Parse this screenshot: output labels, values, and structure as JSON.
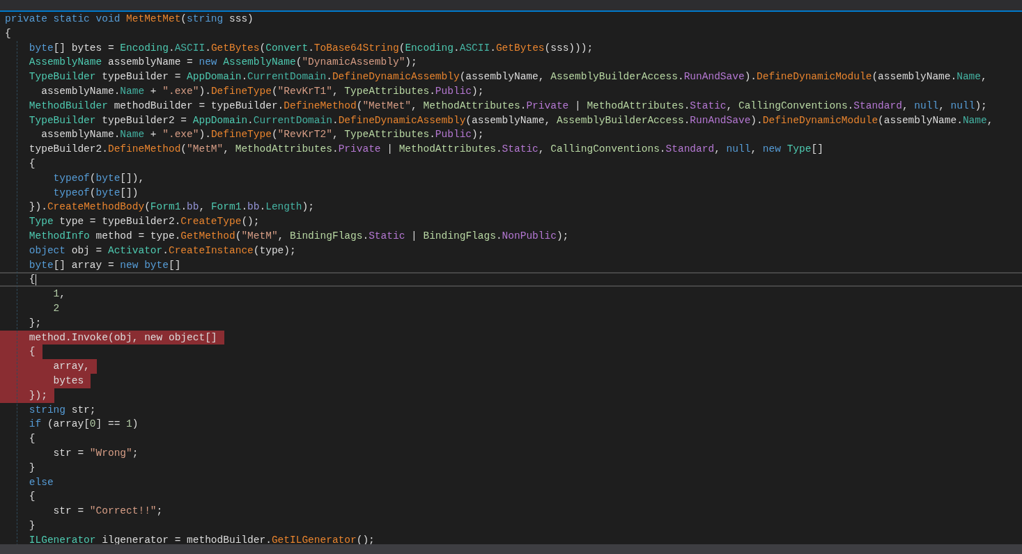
{
  "code_lines": [
    {
      "highlighted": false,
      "current": false,
      "tokens": [
        {
          "kind": "keyword",
          "text": "private static void "
        },
        {
          "kind": "method",
          "text": "MetMetMet"
        },
        {
          "kind": "plain",
          "text": "("
        },
        {
          "kind": "keyword",
          "text": "string"
        },
        {
          "kind": "plain",
          "text": " sss)"
        }
      ]
    },
    {
      "highlighted": false,
      "current": false,
      "tokens": [
        {
          "kind": "plain",
          "text": "{"
        }
      ]
    },
    {
      "highlighted": false,
      "current": false,
      "tokens": [
        {
          "kind": "keyword",
          "text": "    byte"
        },
        {
          "kind": "plain",
          "text": "[] bytes = "
        },
        {
          "kind": "type",
          "text": "Encoding"
        },
        {
          "kind": "plain",
          "text": "."
        },
        {
          "kind": "property",
          "text": "ASCII"
        },
        {
          "kind": "plain",
          "text": "."
        },
        {
          "kind": "method",
          "text": "GetBytes"
        },
        {
          "kind": "plain",
          "text": "("
        },
        {
          "kind": "type",
          "text": "Convert"
        },
        {
          "kind": "plain",
          "text": "."
        },
        {
          "kind": "method",
          "text": "ToBase64String"
        },
        {
          "kind": "plain",
          "text": "("
        },
        {
          "kind": "type",
          "text": "Encoding"
        },
        {
          "kind": "plain",
          "text": "."
        },
        {
          "kind": "property",
          "text": "ASCII"
        },
        {
          "kind": "plain",
          "text": "."
        },
        {
          "kind": "method",
          "text": "GetBytes"
        },
        {
          "kind": "plain",
          "text": "(sss)));"
        }
      ]
    },
    {
      "highlighted": false,
      "current": false,
      "tokens": [
        {
          "kind": "type",
          "text": "    AssemblyName"
        },
        {
          "kind": "plain",
          "text": " assemblyName = "
        },
        {
          "kind": "keyword",
          "text": "new "
        },
        {
          "kind": "type",
          "text": "AssemblyName"
        },
        {
          "kind": "plain",
          "text": "("
        },
        {
          "kind": "string",
          "text": "\"DynamicAssembly\""
        },
        {
          "kind": "plain",
          "text": ");"
        }
      ]
    },
    {
      "highlighted": false,
      "current": false,
      "tokens": [
        {
          "kind": "type",
          "text": "    TypeBuilder"
        },
        {
          "kind": "plain",
          "text": " typeBuilder = "
        },
        {
          "kind": "type",
          "text": "AppDomain"
        },
        {
          "kind": "plain",
          "text": "."
        },
        {
          "kind": "property",
          "text": "CurrentDomain"
        },
        {
          "kind": "plain",
          "text": "."
        },
        {
          "kind": "method",
          "text": "DefineDynamicAssembly"
        },
        {
          "kind": "plain",
          "text": "(assemblyName, "
        },
        {
          "kind": "enum",
          "text": "AssemblyBuilderAccess"
        },
        {
          "kind": "plain",
          "text": "."
        },
        {
          "kind": "value",
          "text": "RunAndSave"
        },
        {
          "kind": "plain",
          "text": ")."
        },
        {
          "kind": "method",
          "text": "DefineDynamicModule"
        },
        {
          "kind": "plain",
          "text": "(assemblyName."
        },
        {
          "kind": "property",
          "text": "Name"
        },
        {
          "kind": "plain",
          "text": ","
        }
      ]
    },
    {
      "highlighted": false,
      "current": false,
      "tokens": [
        {
          "kind": "plain",
          "text": "      assemblyName."
        },
        {
          "kind": "property",
          "text": "Name"
        },
        {
          "kind": "plain",
          "text": " + "
        },
        {
          "kind": "string",
          "text": "\".exe\""
        },
        {
          "kind": "plain",
          "text": ")."
        },
        {
          "kind": "method",
          "text": "DefineType"
        },
        {
          "kind": "plain",
          "text": "("
        },
        {
          "kind": "string",
          "text": "\"RevKrT1\""
        },
        {
          "kind": "plain",
          "text": ", "
        },
        {
          "kind": "enum",
          "text": "TypeAttributes"
        },
        {
          "kind": "plain",
          "text": "."
        },
        {
          "kind": "value",
          "text": "Public"
        },
        {
          "kind": "plain",
          "text": ");"
        }
      ]
    },
    {
      "highlighted": false,
      "current": false,
      "tokens": [
        {
          "kind": "type",
          "text": "    MethodBuilder"
        },
        {
          "kind": "plain",
          "text": " methodBuilder = typeBuilder."
        },
        {
          "kind": "method",
          "text": "DefineMethod"
        },
        {
          "kind": "plain",
          "text": "("
        },
        {
          "kind": "string",
          "text": "\"MetMet\""
        },
        {
          "kind": "plain",
          "text": ", "
        },
        {
          "kind": "enum",
          "text": "MethodAttributes"
        },
        {
          "kind": "plain",
          "text": "."
        },
        {
          "kind": "value",
          "text": "Private"
        },
        {
          "kind": "plain",
          "text": " | "
        },
        {
          "kind": "enum",
          "text": "MethodAttributes"
        },
        {
          "kind": "plain",
          "text": "."
        },
        {
          "kind": "value",
          "text": "Static"
        },
        {
          "kind": "plain",
          "text": ", "
        },
        {
          "kind": "enum",
          "text": "CallingConventions"
        },
        {
          "kind": "plain",
          "text": "."
        },
        {
          "kind": "value",
          "text": "Standard"
        },
        {
          "kind": "plain",
          "text": ", "
        },
        {
          "kind": "keyword",
          "text": "null"
        },
        {
          "kind": "plain",
          "text": ", "
        },
        {
          "kind": "keyword",
          "text": "null"
        },
        {
          "kind": "plain",
          "text": ");"
        }
      ]
    },
    {
      "highlighted": false,
      "current": false,
      "tokens": [
        {
          "kind": "type",
          "text": "    TypeBuilder"
        },
        {
          "kind": "plain",
          "text": " typeBuilder2 = "
        },
        {
          "kind": "type",
          "text": "AppDomain"
        },
        {
          "kind": "plain",
          "text": "."
        },
        {
          "kind": "property",
          "text": "CurrentDomain"
        },
        {
          "kind": "plain",
          "text": "."
        },
        {
          "kind": "method",
          "text": "DefineDynamicAssembly"
        },
        {
          "kind": "plain",
          "text": "(assemblyName, "
        },
        {
          "kind": "enum",
          "text": "AssemblyBuilderAccess"
        },
        {
          "kind": "plain",
          "text": "."
        },
        {
          "kind": "value",
          "text": "RunAndSave"
        },
        {
          "kind": "plain",
          "text": ")."
        },
        {
          "kind": "method",
          "text": "DefineDynamicModule"
        },
        {
          "kind": "plain",
          "text": "(assemblyName."
        },
        {
          "kind": "property",
          "text": "Name"
        },
        {
          "kind": "plain",
          "text": ","
        }
      ]
    },
    {
      "highlighted": false,
      "current": false,
      "tokens": [
        {
          "kind": "plain",
          "text": "      assemblyName."
        },
        {
          "kind": "property",
          "text": "Name"
        },
        {
          "kind": "plain",
          "text": " + "
        },
        {
          "kind": "string",
          "text": "\".exe\""
        },
        {
          "kind": "plain",
          "text": ")."
        },
        {
          "kind": "method",
          "text": "DefineType"
        },
        {
          "kind": "plain",
          "text": "("
        },
        {
          "kind": "string",
          "text": "\"RevKrT2\""
        },
        {
          "kind": "plain",
          "text": ", "
        },
        {
          "kind": "enum",
          "text": "TypeAttributes"
        },
        {
          "kind": "plain",
          "text": "."
        },
        {
          "kind": "value",
          "text": "Public"
        },
        {
          "kind": "plain",
          "text": ");"
        }
      ]
    },
    {
      "highlighted": false,
      "current": false,
      "tokens": [
        {
          "kind": "plain",
          "text": "    typeBuilder2."
        },
        {
          "kind": "method",
          "text": "DefineMethod"
        },
        {
          "kind": "plain",
          "text": "("
        },
        {
          "kind": "string",
          "text": "\"MetM\""
        },
        {
          "kind": "plain",
          "text": ", "
        },
        {
          "kind": "enum",
          "text": "MethodAttributes"
        },
        {
          "kind": "plain",
          "text": "."
        },
        {
          "kind": "value",
          "text": "Private"
        },
        {
          "kind": "plain",
          "text": " | "
        },
        {
          "kind": "enum",
          "text": "MethodAttributes"
        },
        {
          "kind": "plain",
          "text": "."
        },
        {
          "kind": "value",
          "text": "Static"
        },
        {
          "kind": "plain",
          "text": ", "
        },
        {
          "kind": "enum",
          "text": "CallingConventions"
        },
        {
          "kind": "plain",
          "text": "."
        },
        {
          "kind": "value",
          "text": "Standard"
        },
        {
          "kind": "plain",
          "text": ", "
        },
        {
          "kind": "keyword",
          "text": "null"
        },
        {
          "kind": "plain",
          "text": ", "
        },
        {
          "kind": "keyword",
          "text": "new "
        },
        {
          "kind": "type",
          "text": "Type"
        },
        {
          "kind": "plain",
          "text": "[]"
        }
      ]
    },
    {
      "highlighted": false,
      "current": false,
      "tokens": [
        {
          "kind": "plain",
          "text": "    {"
        }
      ]
    },
    {
      "highlighted": false,
      "current": false,
      "tokens": [
        {
          "kind": "keyword",
          "text": "        typeof"
        },
        {
          "kind": "plain",
          "text": "("
        },
        {
          "kind": "keyword",
          "text": "byte"
        },
        {
          "kind": "plain",
          "text": "[]),"
        }
      ]
    },
    {
      "highlighted": false,
      "current": false,
      "tokens": [
        {
          "kind": "keyword",
          "text": "        typeof"
        },
        {
          "kind": "plain",
          "text": "("
        },
        {
          "kind": "keyword",
          "text": "byte"
        },
        {
          "kind": "plain",
          "text": "[])"
        }
      ]
    },
    {
      "highlighted": false,
      "current": false,
      "tokens": [
        {
          "kind": "plain",
          "text": "    })."
        },
        {
          "kind": "method",
          "text": "CreateMethodBody"
        },
        {
          "kind": "plain",
          "text": "("
        },
        {
          "kind": "type",
          "text": "Form1"
        },
        {
          "kind": "plain",
          "text": "."
        },
        {
          "kind": "field",
          "text": "bb"
        },
        {
          "kind": "plain",
          "text": ", "
        },
        {
          "kind": "type",
          "text": "Form1"
        },
        {
          "kind": "plain",
          "text": "."
        },
        {
          "kind": "field",
          "text": "bb"
        },
        {
          "kind": "plain",
          "text": "."
        },
        {
          "kind": "property",
          "text": "Length"
        },
        {
          "kind": "plain",
          "text": ");"
        }
      ]
    },
    {
      "highlighted": false,
      "current": false,
      "tokens": [
        {
          "kind": "type",
          "text": "    Type"
        },
        {
          "kind": "plain",
          "text": " type = typeBuilder2."
        },
        {
          "kind": "method",
          "text": "CreateType"
        },
        {
          "kind": "plain",
          "text": "();"
        }
      ]
    },
    {
      "highlighted": false,
      "current": false,
      "tokens": [
        {
          "kind": "type",
          "text": "    MethodInfo"
        },
        {
          "kind": "plain",
          "text": " method = type."
        },
        {
          "kind": "method",
          "text": "GetMethod"
        },
        {
          "kind": "plain",
          "text": "("
        },
        {
          "kind": "string",
          "text": "\"MetM\""
        },
        {
          "kind": "plain",
          "text": ", "
        },
        {
          "kind": "enum",
          "text": "BindingFlags"
        },
        {
          "kind": "plain",
          "text": "."
        },
        {
          "kind": "value",
          "text": "Static"
        },
        {
          "kind": "plain",
          "text": " | "
        },
        {
          "kind": "enum",
          "text": "BindingFlags"
        },
        {
          "kind": "plain",
          "text": "."
        },
        {
          "kind": "value",
          "text": "NonPublic"
        },
        {
          "kind": "plain",
          "text": ");"
        }
      ]
    },
    {
      "highlighted": false,
      "current": false,
      "tokens": [
        {
          "kind": "keyword",
          "text": "    object"
        },
        {
          "kind": "plain",
          "text": " obj = "
        },
        {
          "kind": "type",
          "text": "Activator"
        },
        {
          "kind": "plain",
          "text": "."
        },
        {
          "kind": "method",
          "text": "CreateInstance"
        },
        {
          "kind": "plain",
          "text": "(type);"
        }
      ]
    },
    {
      "highlighted": false,
      "current": false,
      "tokens": [
        {
          "kind": "keyword",
          "text": "    byte"
        },
        {
          "kind": "plain",
          "text": "[] array = "
        },
        {
          "kind": "keyword",
          "text": "new byte"
        },
        {
          "kind": "plain",
          "text": "[]"
        }
      ]
    },
    {
      "highlighted": false,
      "current": true,
      "tokens": [
        {
          "kind": "plain",
          "text": "    {"
        }
      ]
    },
    {
      "highlighted": false,
      "current": false,
      "tokens": [
        {
          "kind": "number",
          "text": "        1"
        },
        {
          "kind": "plain",
          "text": ","
        }
      ]
    },
    {
      "highlighted": false,
      "current": false,
      "tokens": [
        {
          "kind": "number",
          "text": "        2"
        }
      ]
    },
    {
      "highlighted": false,
      "current": false,
      "tokens": [
        {
          "kind": "plain",
          "text": "    };"
        }
      ]
    },
    {
      "highlighted": true,
      "current": false,
      "tokens": [
        {
          "kind": "plain",
          "text": "    method.Invoke(obj, new object[]"
        }
      ]
    },
    {
      "highlighted": true,
      "current": false,
      "tokens": [
        {
          "kind": "plain",
          "text": "    {"
        }
      ]
    },
    {
      "highlighted": true,
      "current": false,
      "tokens": [
        {
          "kind": "plain",
          "text": "        array,"
        }
      ]
    },
    {
      "highlighted": true,
      "current": false,
      "tokens": [
        {
          "kind": "plain",
          "text": "        bytes"
        }
      ]
    },
    {
      "highlighted": true,
      "current": false,
      "tokens": [
        {
          "kind": "plain",
          "text": "    });"
        }
      ]
    },
    {
      "highlighted": false,
      "current": false,
      "tokens": [
        {
          "kind": "keyword",
          "text": "    string"
        },
        {
          "kind": "plain",
          "text": " str;"
        }
      ]
    },
    {
      "highlighted": false,
      "current": false,
      "tokens": [
        {
          "kind": "keyword",
          "text": "    if"
        },
        {
          "kind": "plain",
          "text": " (array["
        },
        {
          "kind": "number",
          "text": "0"
        },
        {
          "kind": "plain",
          "text": "] == "
        },
        {
          "kind": "number",
          "text": "1"
        },
        {
          "kind": "plain",
          "text": ")"
        }
      ]
    },
    {
      "highlighted": false,
      "current": false,
      "tokens": [
        {
          "kind": "plain",
          "text": "    {"
        }
      ]
    },
    {
      "highlighted": false,
      "current": false,
      "tokens": [
        {
          "kind": "plain",
          "text": "        str = "
        },
        {
          "kind": "string",
          "text": "\"Wrong\""
        },
        {
          "kind": "plain",
          "text": ";"
        }
      ]
    },
    {
      "highlighted": false,
      "current": false,
      "tokens": [
        {
          "kind": "plain",
          "text": "    }"
        }
      ]
    },
    {
      "highlighted": false,
      "current": false,
      "tokens": [
        {
          "kind": "keyword",
          "text": "    else"
        }
      ]
    },
    {
      "highlighted": false,
      "current": false,
      "tokens": [
        {
          "kind": "plain",
          "text": "    {"
        }
      ]
    },
    {
      "highlighted": false,
      "current": false,
      "tokens": [
        {
          "kind": "plain",
          "text": "        str = "
        },
        {
          "kind": "string",
          "text": "\"Correct!!\""
        },
        {
          "kind": "plain",
          "text": ";"
        }
      ]
    },
    {
      "highlighted": false,
      "current": false,
      "tokens": [
        {
          "kind": "plain",
          "text": "    }"
        }
      ]
    },
    {
      "highlighted": false,
      "current": false,
      "tokens": [
        {
          "kind": "type",
          "text": "    ILGenerator"
        },
        {
          "kind": "plain",
          "text": " ilgenerator = methodBuilder."
        },
        {
          "kind": "method",
          "text": "GetILGenerator"
        },
        {
          "kind": "plain",
          "text": "();"
        }
      ]
    }
  ]
}
